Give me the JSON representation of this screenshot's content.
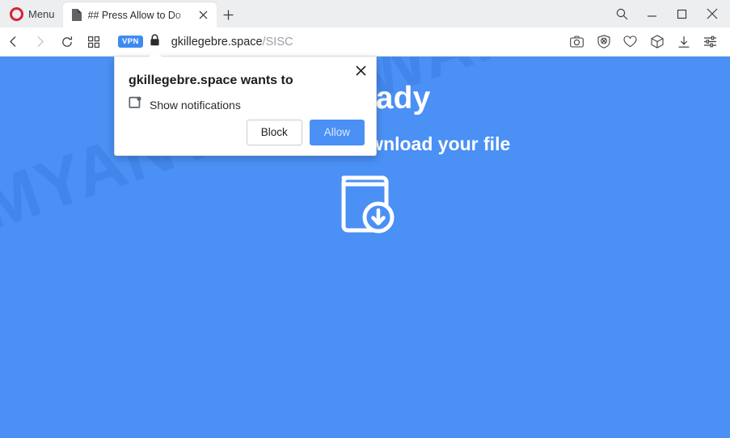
{
  "browser": {
    "menu_label": "Menu",
    "opera_logo_icon": "opera-logo-icon",
    "tab": {
      "title": "## Press Allow to Do",
      "favicon_icon": "page-favicon-icon",
      "close_icon": "close-icon"
    },
    "new_tab_icon": "plus-icon",
    "window_controls": {
      "search_icon": "search-icon",
      "minimize_icon": "minimize-icon",
      "maximize_icon": "maximize-icon",
      "close_icon": "close-icon"
    },
    "nav": {
      "back_icon": "chevron-left-icon",
      "forward_icon": "chevron-right-icon",
      "reload_icon": "reload-icon",
      "speeddial_icon": "grid-icon"
    },
    "address": {
      "vpn_badge": "VPN",
      "lock_icon": "lock-icon",
      "domain": "gkillegebre.space",
      "path": "/SISC"
    },
    "toolbar_icons": [
      "camera-icon",
      "ad-blocker-shield-icon",
      "heart-icon",
      "cube-icon",
      "download-icon",
      "easy-setup-sliders-icon"
    ]
  },
  "permission_dialog": {
    "title": "gkillegebre.space wants to",
    "permission_icon": "show-notifications-icon",
    "permission_label": "Show notifications",
    "block_label": "Block",
    "allow_label": "Allow",
    "close_icon": "close-icon"
  },
  "page": {
    "title": "Is Ready",
    "subtitle": "Click Allow to download your file",
    "download_graphic_icon": "book-download-icon",
    "watermark": "MYANTISPYWARE.COM",
    "background_color": "#4a90f5",
    "accent_color": "#4a90f5"
  }
}
